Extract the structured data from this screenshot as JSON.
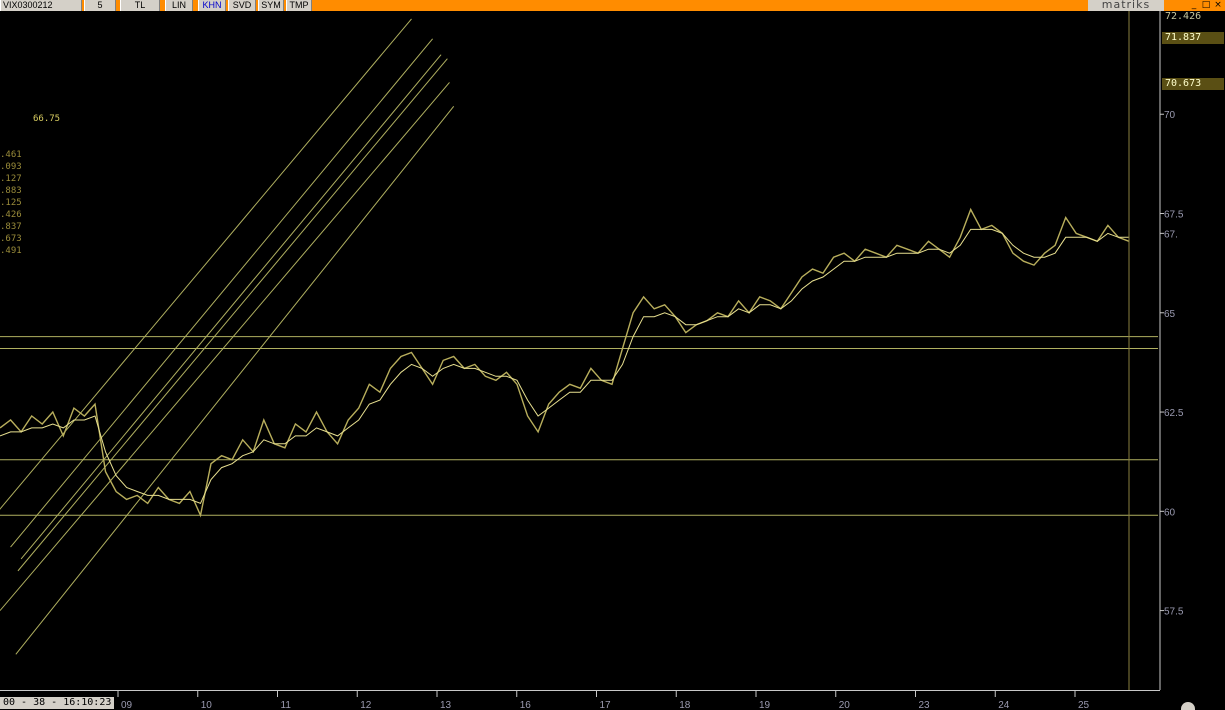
{
  "toolbar": {
    "symbol": "VIX0300212",
    "period": "5",
    "buttons": [
      "TL",
      "LIN",
      "KHN",
      "SVD",
      "SYM",
      "TMP"
    ],
    "active_button": "KHN",
    "logo": "matriks",
    "window_controls": [
      "_",
      "□",
      "×"
    ]
  },
  "price_boxes": [
    "72.426",
    "71.837",
    "70.673"
  ],
  "left_readout": {
    "current": "66.75",
    "values": [
      ".461",
      ".093",
      ".127",
      ".883",
      ".125",
      ".426",
      ".837",
      ".673",
      ".491"
    ]
  },
  "footer": {
    "time": "00 - 38 - 16:10:23"
  },
  "chart_data": {
    "type": "line",
    "x_tick_labels": [
      "09",
      "10",
      "11",
      "12",
      "13",
      "16",
      "17",
      "18",
      "19",
      "20",
      "23",
      "24",
      "25"
    ],
    "y_tick_labels": [
      "70",
      "67.5",
      "67.",
      "65",
      "62.5",
      "60",
      "57.5"
    ],
    "ylim": [
      55.5,
      72.6
    ],
    "grid": false,
    "colors": {
      "price": "#b8ae5c",
      "average": "#e8e090",
      "trendline": "#b0b060",
      "axis": "#9a9ab0"
    },
    "series": [
      {
        "values": [
          62.1,
          62.3,
          62.0,
          62.4,
          62.2,
          62.5,
          61.9,
          62.6,
          62.4,
          62.7,
          61.0,
          60.5,
          60.3,
          60.4,
          60.2,
          60.6,
          60.3,
          60.2,
          60.5,
          59.9,
          61.2,
          61.4,
          61.3,
          61.8,
          61.5,
          62.3,
          61.7,
          61.6,
          62.2,
          62.0,
          62.5,
          62.0,
          61.7,
          62.3,
          62.6,
          63.2,
          63.0,
          63.6,
          63.9,
          64.0,
          63.6,
          63.2,
          63.8,
          63.9,
          63.6,
          63.7,
          63.4,
          63.3,
          63.5,
          63.2,
          62.4,
          62.0,
          62.7,
          63.0,
          63.2,
          63.1,
          63.6,
          63.3,
          63.2,
          64.1,
          65.0,
          65.4,
          65.1,
          65.2,
          64.9,
          64.5,
          64.7,
          64.8,
          65.0,
          64.9,
          65.3,
          65.0,
          65.4,
          65.3,
          65.1,
          65.5,
          65.9,
          66.1,
          66.0,
          66.4,
          66.5,
          66.3,
          66.6,
          66.5,
          66.4,
          66.7,
          66.6,
          66.5,
          66.8,
          66.6,
          66.4,
          66.9,
          67.6,
          67.1,
          67.2,
          67.0,
          66.5,
          66.3,
          66.2,
          66.5,
          66.7,
          67.4,
          67.0,
          66.9,
          66.8,
          67.2,
          66.9,
          66.8
        ]
      },
      {
        "values": [
          61.9,
          62.0,
          62.0,
          62.1,
          62.1,
          62.2,
          62.1,
          62.3,
          62.3,
          62.4,
          61.5,
          60.9,
          60.6,
          60.5,
          60.4,
          60.4,
          60.3,
          60.3,
          60.3,
          60.2,
          60.8,
          61.1,
          61.2,
          61.4,
          61.5,
          61.8,
          61.7,
          61.7,
          61.9,
          61.9,
          62.1,
          62.0,
          61.9,
          62.1,
          62.3,
          62.7,
          62.8,
          63.2,
          63.5,
          63.7,
          63.6,
          63.4,
          63.6,
          63.7,
          63.6,
          63.6,
          63.5,
          63.4,
          63.4,
          63.3,
          62.8,
          62.4,
          62.6,
          62.8,
          63.0,
          63.0,
          63.3,
          63.3,
          63.3,
          63.7,
          64.4,
          64.9,
          64.9,
          65.0,
          64.9,
          64.7,
          64.7,
          64.8,
          64.9,
          64.9,
          65.1,
          65.0,
          65.2,
          65.2,
          65.1,
          65.3,
          65.6,
          65.8,
          65.9,
          66.1,
          66.3,
          66.3,
          66.4,
          66.4,
          66.4,
          66.5,
          66.5,
          66.5,
          66.6,
          66.6,
          66.5,
          66.7,
          67.1,
          67.1,
          67.1,
          67.0,
          66.7,
          66.5,
          66.4,
          66.4,
          66.5,
          66.9,
          66.9,
          66.9,
          66.8,
          67.0,
          66.9,
          66.9
        ]
      }
    ],
    "horizontal_levels": [
      64.4,
      64.1,
      61.3,
      59.9
    ],
    "trendlines": [
      {
        "from": [
          -0.5,
          59.9
        ],
        "to": [
          39.0,
          72.4
        ]
      },
      {
        "from": [
          1.0,
          59.1
        ],
        "to": [
          41.0,
          71.9
        ]
      },
      {
        "from": [
          2.0,
          58.8
        ],
        "to": [
          41.8,
          71.5
        ]
      },
      {
        "from": [
          1.7,
          58.5
        ],
        "to": [
          42.4,
          71.4
        ]
      },
      {
        "from": [
          0.0,
          57.5
        ],
        "to": [
          42.6,
          70.8
        ]
      },
      {
        "from": [
          1.5,
          56.4
        ],
        "to": [
          43.0,
          70.2
        ]
      }
    ]
  }
}
